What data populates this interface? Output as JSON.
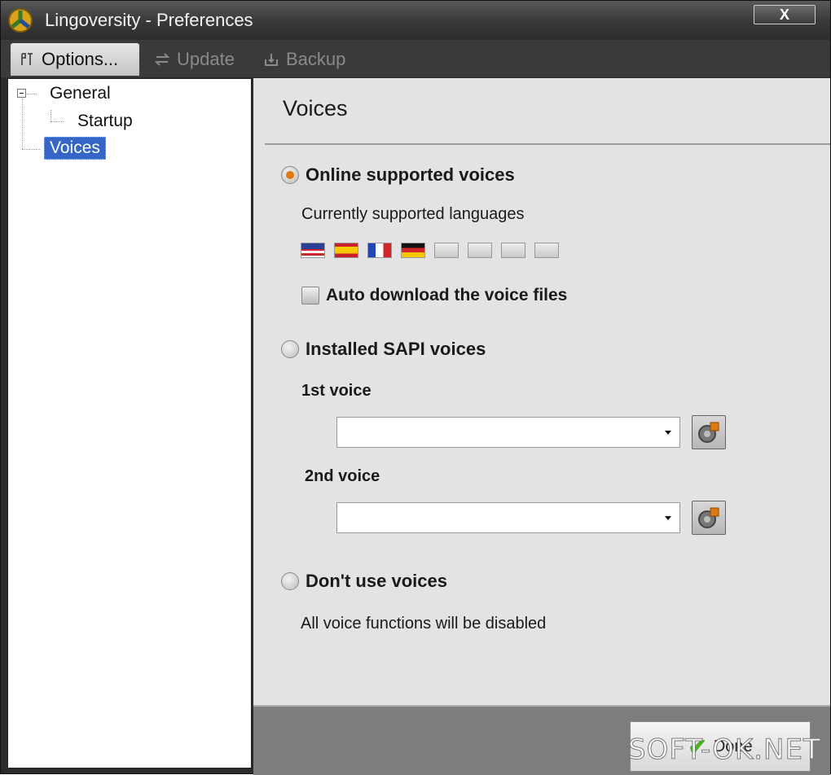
{
  "window": {
    "title": "Lingoversity - Preferences",
    "close_label": "X"
  },
  "toolbar": {
    "tabs": [
      {
        "label": "Options...",
        "icon": "wrench-icon",
        "state": "active"
      },
      {
        "label": "Update",
        "icon": "update-icon",
        "state": "disabled"
      },
      {
        "label": "Backup",
        "icon": "backup-icon",
        "state": "disabled"
      }
    ]
  },
  "tree": {
    "items": [
      {
        "label": "General",
        "expanded": true
      },
      {
        "label": "Startup"
      },
      {
        "label": "Voices",
        "selected": true
      }
    ]
  },
  "voices": {
    "title": "Voices",
    "online": {
      "label": "Online supported voices",
      "checked": true,
      "languages_label": "Currently supported languages",
      "flags": [
        "us",
        "es",
        "fr",
        "de",
        "empty",
        "empty",
        "empty",
        "empty"
      ],
      "auto_download_label": "Auto download the voice files",
      "auto_download_checked": false
    },
    "sapi": {
      "label": "Installed SAPI voices",
      "checked": false,
      "voice1_label": "1st voice",
      "voice1_value": "",
      "voice2_label": "2nd voice",
      "voice2_value": ""
    },
    "none": {
      "label": "Don't use voices",
      "checked": false,
      "description": "All voice functions will be disabled"
    }
  },
  "footer": {
    "done_label": "Done"
  },
  "watermark": "SOFT-OK.NET",
  "colors": {
    "accent": "#e07a10",
    "selection": "#3566c6",
    "titlebar": "#3a3a3a"
  }
}
